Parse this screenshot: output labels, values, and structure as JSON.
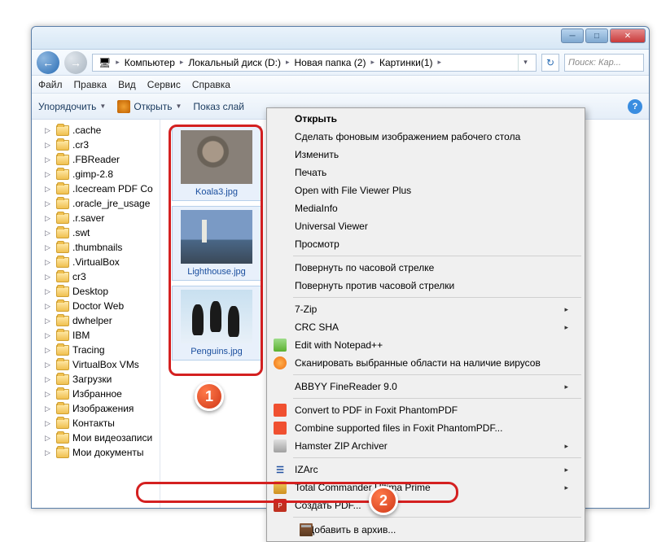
{
  "breadcrumb": {
    "computer": "Компьютер",
    "drive": "Локальный диск (D:)",
    "folder1": "Новая папка (2)",
    "folder2": "Картинки(1)"
  },
  "search": {
    "placeholder": "Поиск: Кар..."
  },
  "menubar": {
    "file": "Файл",
    "edit": "Правка",
    "view": "Вид",
    "service": "Сервис",
    "help": "Справка"
  },
  "toolbar": {
    "organize": "Упорядочить",
    "open": "Открыть",
    "slideshow": "Показ слай"
  },
  "tree": {
    "items": [
      ".cache",
      ".cr3",
      ".FBReader",
      ".gimp-2.8",
      ".Icecream PDF Co",
      ".oracle_jre_usage",
      ".r.saver",
      ".swt",
      ".thumbnails",
      ".VirtualBox",
      "cr3",
      "Desktop",
      "Doctor Web",
      "dwhelper",
      "IBM",
      "Tracing",
      "VirtualBox VMs",
      "Загрузки",
      "Избранное",
      "Изображения",
      "Контакты",
      "Мои видеозаписи",
      "Мои документы"
    ]
  },
  "thumbs": {
    "t1": "Koala3.jpg",
    "t2": "Lighthouse.jpg",
    "t3": "Penguins.jpg"
  },
  "badges": {
    "b1": "1",
    "b2": "2"
  },
  "ctx": {
    "open": "Открыть",
    "wallpaper": "Сделать фоновым изображением рабочего стола",
    "edit": "Изменить",
    "print": "Печать",
    "fileviewer": "Open with File Viewer Plus",
    "mediainfo": "MediaInfo",
    "univiewer": "Universal Viewer",
    "preview": "Просмотр",
    "rotcw": "Повернуть по часовой стрелке",
    "rotccw": "Повернуть против часовой стрелки",
    "sevenzip": "7-Zip",
    "crcsha": "CRC SHA",
    "notepadpp": "Edit with Notepad++",
    "avast": "Сканировать выбранные области на наличие вирусов",
    "abbyy": "ABBYY FineReader 9.0",
    "foxitconv": "Convert to PDF in Foxit PhantomPDF",
    "foxitcomb": "Combine supported files in Foxit PhantomPDF...",
    "hamster": "Hamster ZIP Archiver",
    "izarc": "IZArc",
    "tcup": "Total Commander Ultima Prime",
    "createpdf": "Создать PDF...",
    "addarchive": "Добавить в архив..."
  }
}
